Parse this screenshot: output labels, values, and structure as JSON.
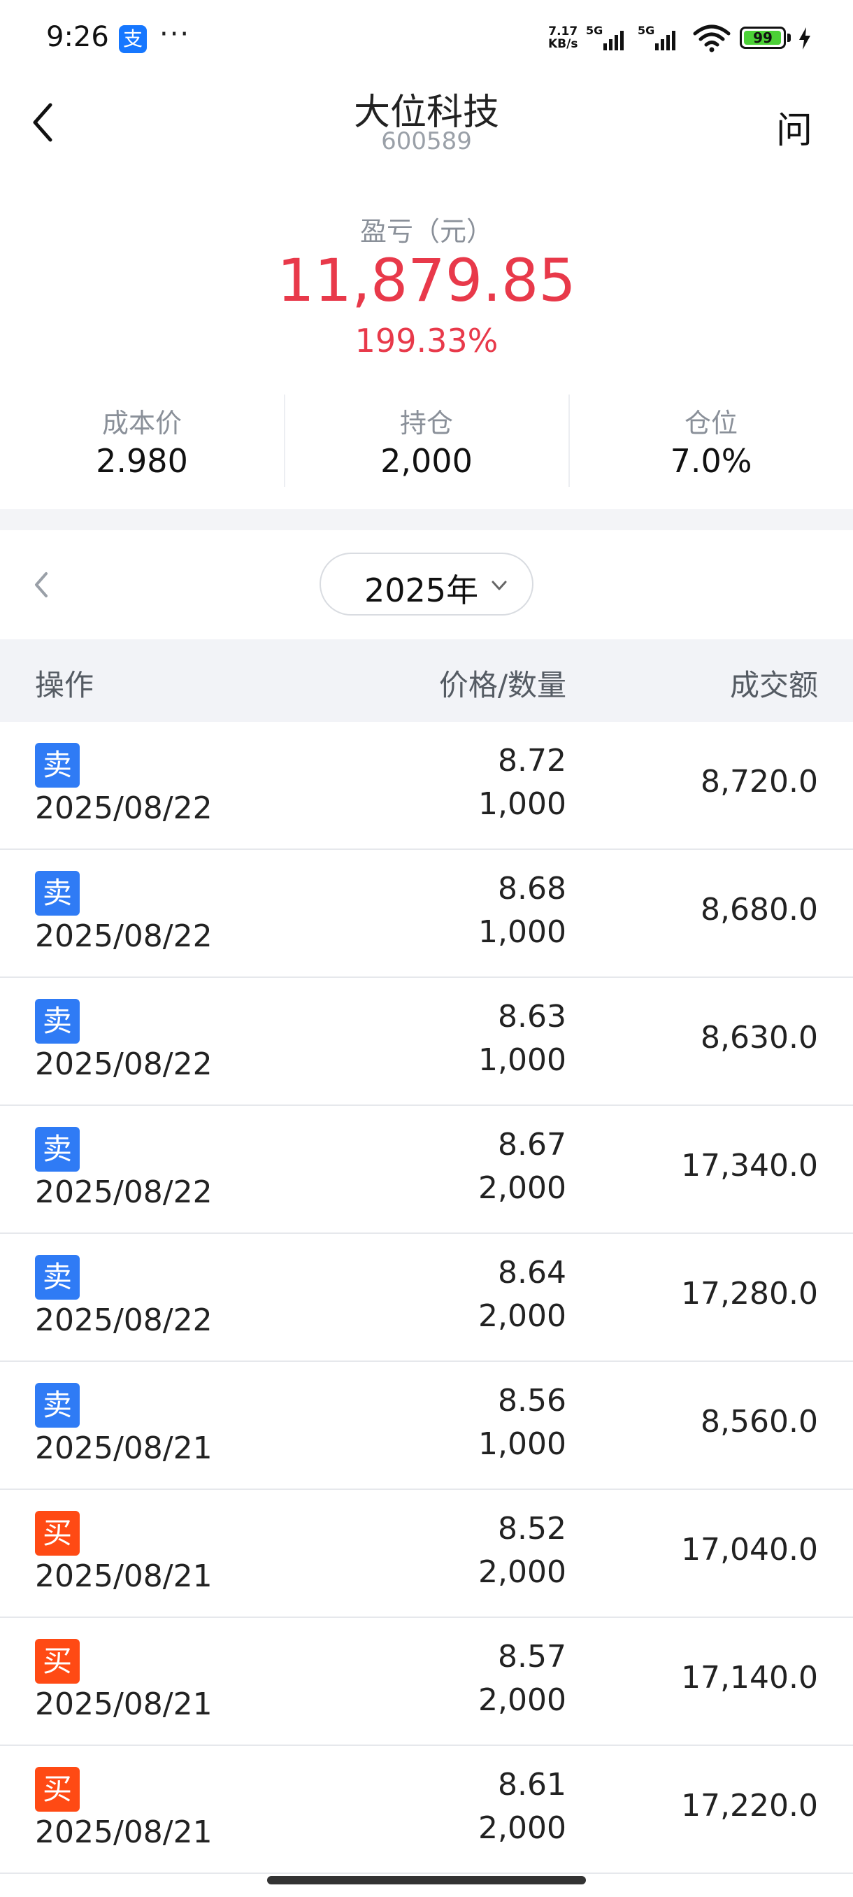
{
  "status_bar": {
    "time": "9:26",
    "app_icon": "支",
    "more": "···",
    "speed_value": "7.17",
    "speed_unit": "KB/s",
    "net1": "5G",
    "net2": "5G",
    "battery": "99",
    "battery_level": 0.99,
    "accent_battery": "#4cd137"
  },
  "header": {
    "title": "大位科技",
    "code": "600589",
    "ask_label": "问"
  },
  "summary": {
    "pl_label": "盈亏（元）",
    "pl_value": "11,879.85",
    "pl_percent": "199.33%",
    "profit_color": "#e8394a"
  },
  "stats": [
    {
      "label": "成本价",
      "value": "2.980"
    },
    {
      "label": "持仓",
      "value": "2,000"
    },
    {
      "label": "仓位",
      "value": "7.0%"
    }
  ],
  "year_selector": {
    "value": "2025年"
  },
  "table": {
    "headers": {
      "operation": "操作",
      "price_qty": "价格/数量",
      "amount": "成交额"
    },
    "sell_color": "#2f7bf5",
    "buy_color": "#ff4a14",
    "rows": [
      {
        "type": "sell",
        "label": "卖",
        "date": "2025/08/22",
        "price": "8.72",
        "qty": "1,000",
        "amount": "8,720.0"
      },
      {
        "type": "sell",
        "label": "卖",
        "date": "2025/08/22",
        "price": "8.68",
        "qty": "1,000",
        "amount": "8,680.0"
      },
      {
        "type": "sell",
        "label": "卖",
        "date": "2025/08/22",
        "price": "8.63",
        "qty": "1,000",
        "amount": "8,630.0"
      },
      {
        "type": "sell",
        "label": "卖",
        "date": "2025/08/22",
        "price": "8.67",
        "qty": "2,000",
        "amount": "17,340.0"
      },
      {
        "type": "sell",
        "label": "卖",
        "date": "2025/08/22",
        "price": "8.64",
        "qty": "2,000",
        "amount": "17,280.0"
      },
      {
        "type": "sell",
        "label": "卖",
        "date": "2025/08/21",
        "price": "8.56",
        "qty": "1,000",
        "amount": "8,560.0"
      },
      {
        "type": "buy",
        "label": "买",
        "date": "2025/08/21",
        "price": "8.52",
        "qty": "2,000",
        "amount": "17,040.0"
      },
      {
        "type": "buy",
        "label": "买",
        "date": "2025/08/21",
        "price": "8.57",
        "qty": "2,000",
        "amount": "17,140.0"
      },
      {
        "type": "buy",
        "label": "买",
        "date": "2025/08/21",
        "price": "8.61",
        "qty": "2,000",
        "amount": "17,220.0"
      }
    ]
  }
}
